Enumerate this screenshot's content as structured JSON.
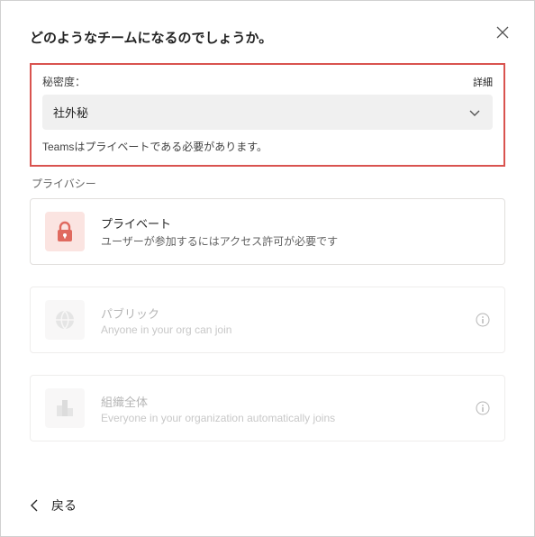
{
  "header": {
    "title": "どのようなチームになるのでしょうか。"
  },
  "sensitivity": {
    "label": "秘密度：",
    "details_link": "詳細",
    "selected_value": "社外秘",
    "hint": "Teamsはプライベートである必要があります。"
  },
  "privacy": {
    "section_label": "プライバシー",
    "options": [
      {
        "title": "プライベート",
        "desc": "ユーザーが参加するにはアクセス許可が必要です",
        "enabled": true,
        "icon": "lock"
      },
      {
        "title": "パブリック",
        "desc": "Anyone in your org can join",
        "enabled": false,
        "icon": "globe"
      },
      {
        "title": "組織全体",
        "desc": "Everyone in your organization automatically joins",
        "enabled": false,
        "icon": "org"
      }
    ]
  },
  "footer": {
    "back": "戻る"
  }
}
